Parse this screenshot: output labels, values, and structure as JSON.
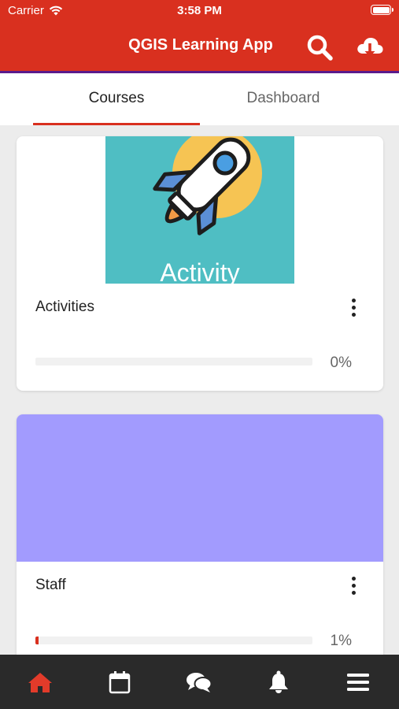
{
  "status": {
    "carrier": "Carrier",
    "time": "3:58 PM"
  },
  "header": {
    "title": "QGIS Learning App",
    "search_icon": "search-icon",
    "download_icon": "cloud-download-icon"
  },
  "tabs": [
    {
      "label": "Courses",
      "active": true
    },
    {
      "label": "Dashboard",
      "active": false
    }
  ],
  "courses": [
    {
      "name": "Activities",
      "progress_label": "0%",
      "progress": 0,
      "banner_text": "Activity",
      "banner_color": "#4fbec3"
    },
    {
      "name": "Staff",
      "progress_label": "1%",
      "progress": 1,
      "banner_color": "#a29bfe"
    }
  ],
  "bottom_nav": [
    {
      "icon": "home-icon",
      "active": true
    },
    {
      "icon": "calendar-icon",
      "active": false
    },
    {
      "icon": "chat-icon",
      "active": false
    },
    {
      "icon": "bell-icon",
      "active": false
    },
    {
      "icon": "menu-icon",
      "active": false
    }
  ],
  "colors": {
    "primary": "#d9301f",
    "accent": "#5a1a8c",
    "nav_bg": "#2a2a2a"
  }
}
